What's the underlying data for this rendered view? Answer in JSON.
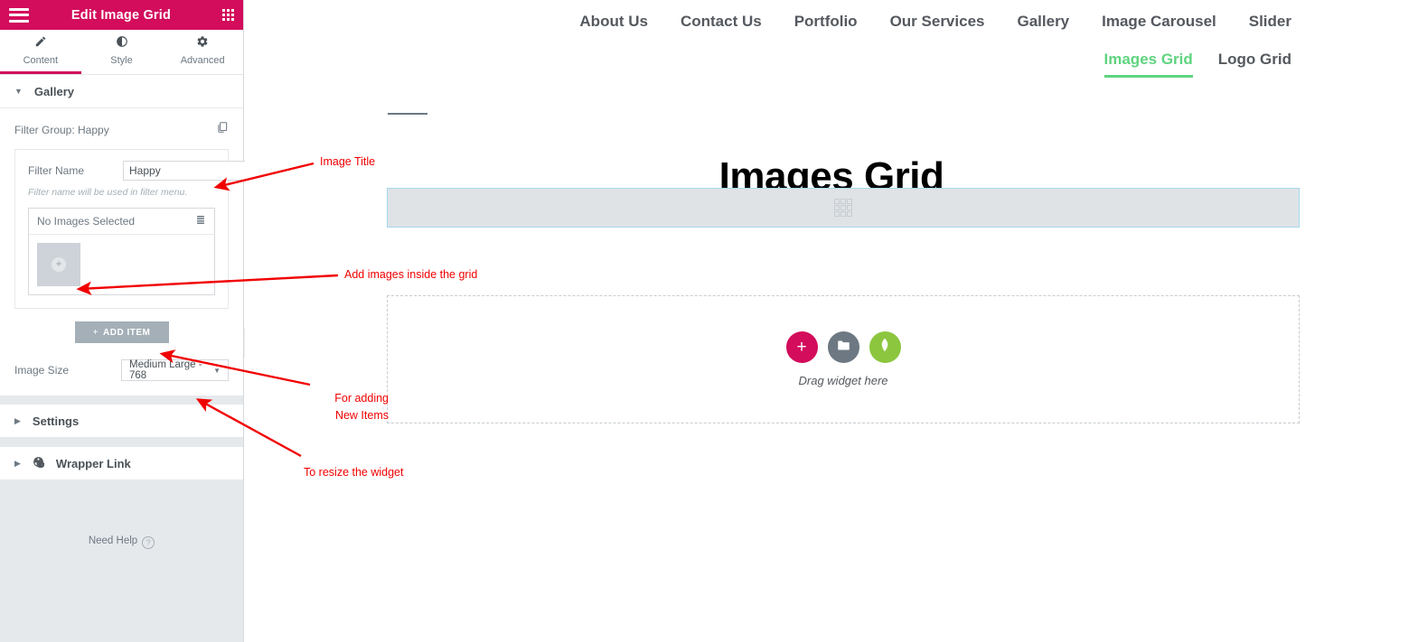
{
  "panel": {
    "title": "Edit Image Grid",
    "menu_icon": "hamburger-icon",
    "grid_icon": "grid-apps-icon",
    "tabs": [
      {
        "label": "Content",
        "icon": "pencil-icon",
        "active": true
      },
      {
        "label": "Style",
        "icon": "contrast-icon",
        "active": false
      },
      {
        "label": "Advanced",
        "icon": "gear-icon",
        "active": false
      }
    ],
    "sections": [
      {
        "label": "Gallery",
        "expanded": true
      },
      {
        "label": "Settings",
        "expanded": false
      },
      {
        "label": "Wrapper Link",
        "expanded": false,
        "icon": "link-chain-icon"
      }
    ],
    "gallery": {
      "filter_group_label": "Filter Group: Happy",
      "copy_icon": "duplicate-icon",
      "filter_name_label": "Filter Name",
      "filter_name_value": "Happy",
      "filter_name_placeholder": "Filter Name",
      "filter_hint": "Filter name will be used in filter menu.",
      "images_selected_text": "No Images Selected",
      "gallery_list_icon": "gallery-list-icon",
      "thumb_add_icon": "plus-circle-icon",
      "add_item_label": "ADD ITEM",
      "add_item_plus": "+",
      "image_size_label": "Image Size",
      "image_size_value": "Medium Large - 768"
    },
    "need_help": {
      "label": "Need Help",
      "icon": "question-mark-icon"
    },
    "collapse_handle_icon": "chevron-left-icon"
  },
  "preview": {
    "topnav": [
      "About Us",
      "Contact Us",
      "Portfolio",
      "Our Services",
      "Gallery",
      "Image Carousel",
      "Slider"
    ],
    "subnav": [
      {
        "label": "Images Grid",
        "active": true
      },
      {
        "label": "Logo Grid",
        "active": false
      }
    ],
    "page_title": "Images Grid",
    "section_placeholder_icon": "grid-3x3-icon",
    "dropzone": {
      "text": "Drag widget here",
      "buttons": [
        {
          "name": "add-element-button",
          "icon": "plus-icon",
          "color": "#d30c5c"
        },
        {
          "name": "add-template-button",
          "icon": "folder-icon",
          "color": "#6d7882"
        },
        {
          "name": "global-widget-button",
          "icon": "leaf-icon",
          "color": "#8cc63e"
        }
      ]
    }
  },
  "annotations": [
    {
      "id": "image-title",
      "text": "Image Title"
    },
    {
      "id": "add-images",
      "text": "Add images inside the grid"
    },
    {
      "id": "for-adding-new-items",
      "text": "For adding\nNew Items"
    },
    {
      "id": "to-resize-widget",
      "text": "To resize the widget"
    }
  ],
  "colors": {
    "brand_pink": "#d30c5c",
    "accent_green": "#5fd47f",
    "annotation_red": "#f10000",
    "panel_bg": "#e6e9ec",
    "section_blue_border": "#a5d8ee"
  }
}
